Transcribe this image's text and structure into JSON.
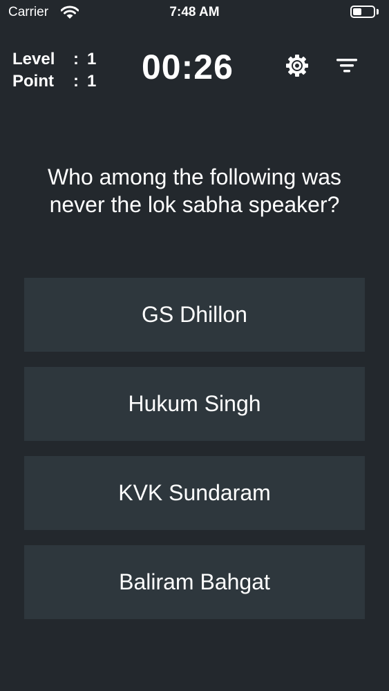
{
  "status_bar": {
    "carrier": "Carrier",
    "time": "7:48 AM"
  },
  "header": {
    "level_label": "Level",
    "level_value": "1",
    "point_label": "Point",
    "point_value": "1",
    "timer": "00:26",
    "settings_icon": "gear-icon",
    "filter_icon": "filter-icon"
  },
  "quiz": {
    "question": "Who among the following was never the lok sabha speaker?",
    "answers": [
      "GS Dhillon",
      "Hukum Singh",
      "KVK Sundaram",
      "Baliram Bahgat"
    ]
  },
  "colors": {
    "background": "#23282d",
    "answer_background": "#2e373d",
    "text": "#ffffff"
  }
}
